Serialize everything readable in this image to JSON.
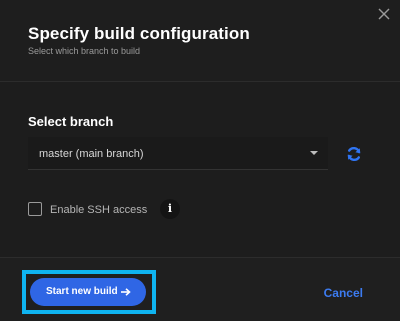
{
  "dialog": {
    "title": "Specify build configuration",
    "subtitle": "Select which branch to build",
    "close_icon": "close-icon"
  },
  "branch": {
    "label": "Select branch",
    "selected": "master (main branch)",
    "refresh_icon": "refresh-icon"
  },
  "ssh": {
    "label": "Enable SSH access",
    "checked": false,
    "info_icon": "info-icon",
    "info_glyph": "i"
  },
  "footer": {
    "primary_label": "Start new build",
    "cancel_label": "Cancel",
    "arrow_icon": "arrow-right-icon"
  },
  "colors": {
    "background": "#1f1f1f",
    "primary": "#2f66e5",
    "link": "#3c7bf0",
    "highlight": "#0fb4f0"
  }
}
